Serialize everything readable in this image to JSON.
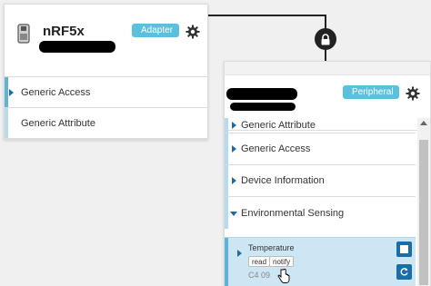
{
  "adapter_card": {
    "device_name": "nRF5x",
    "badge": "Adapter",
    "services": [
      "Generic Access",
      "Generic Attribute"
    ]
  },
  "peripheral_card": {
    "badge": "Peripheral",
    "services": [
      {
        "label": "Generic Attribute",
        "expanded": false
      },
      {
        "label": "Generic Access",
        "expanded": false
      },
      {
        "label": "Device Information",
        "expanded": false
      },
      {
        "label": "Environmental Sensing",
        "expanded": true
      }
    ],
    "characteristic": {
      "name": "Temperature",
      "properties": [
        "read",
        "notify"
      ],
      "value": "C4 09"
    }
  },
  "colors": {
    "accent": "#5bc0de",
    "highlight": "#cde6f3",
    "primary_blue": "#1a6ea8"
  },
  "icons": [
    "usb-icon",
    "gear-icon",
    "lock-icon",
    "stop-icon",
    "refresh-icon",
    "hand-cursor-icon"
  ]
}
